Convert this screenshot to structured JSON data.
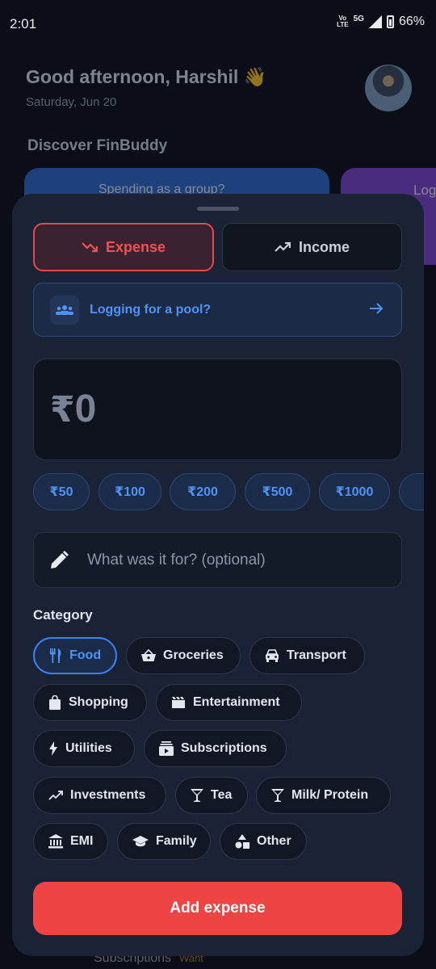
{
  "status": {
    "time": "2:01",
    "volte_top": "Vo",
    "volte_bottom": "LTE",
    "network": "5G",
    "battery": "66%"
  },
  "home": {
    "greeting": "Good afternoon, Harshil 👋",
    "date": "Saturday, Jun 20",
    "discover_title": "Discover FinBuddy",
    "promo_1": "Spending as a group?",
    "promo_2": "Log",
    "bottom_item": "Subscriptions",
    "bottom_tag": "Want"
  },
  "sheet": {
    "type_toggle": {
      "expense": "Expense",
      "income": "Income",
      "selected": "Expense"
    },
    "pool_banner": "Logging for a pool?",
    "amount": {
      "currency": "₹",
      "value": "0"
    },
    "quick_amounts": [
      "₹50",
      "₹100",
      "₹200",
      "₹500",
      "₹1000"
    ],
    "note_placeholder": "What was it for? (optional)",
    "category_title": "Category",
    "categories": [
      "Food",
      "Groceries",
      "Transport",
      "Shopping",
      "Entertainment",
      "Utilities",
      "Subscriptions",
      "Investments",
      "Tea",
      "Milk/ Protein",
      "EMI",
      "Family",
      "Other"
    ],
    "selected_category": "Food",
    "submit": "Add expense"
  },
  "colors": {
    "accent_red": "#ef4444",
    "accent_blue": "#3b82f6",
    "sheet_bg": "#1a2235"
  }
}
